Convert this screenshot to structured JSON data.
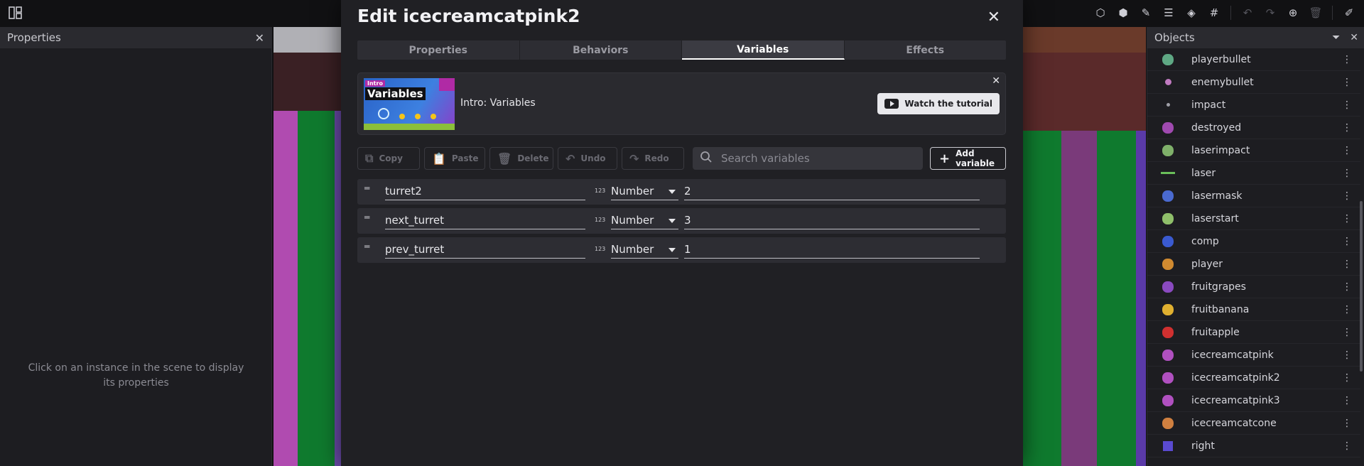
{
  "left_panel": {
    "title": "Properties",
    "empty_message": "Click on an instance in the scene to display its properties"
  },
  "objects_panel": {
    "title": "Objects",
    "items": [
      {
        "name": "playerbullet",
        "icon": "heart-icon",
        "color": "#5fa884"
      },
      {
        "name": "enemybullet",
        "icon": "dot-icon",
        "color": "#c07ac0"
      },
      {
        "name": "impact",
        "icon": "small-dot-icon",
        "color": "#a0a0a8"
      },
      {
        "name": "destroyed",
        "icon": "blob-icon",
        "color": "#a04ab0"
      },
      {
        "name": "laserimpact",
        "icon": "orb-icon",
        "color": "#7fb06a"
      },
      {
        "name": "laser",
        "icon": "line-icon",
        "color": "#6abf5a"
      },
      {
        "name": "lasermask",
        "icon": "mask-icon",
        "color": "#4a6ad0"
      },
      {
        "name": "laserstart",
        "icon": "orb-icon",
        "color": "#8fbf6a"
      },
      {
        "name": "comp",
        "icon": "robot-icon",
        "color": "#3a5ad0"
      },
      {
        "name": "player",
        "icon": "cat-icon",
        "color": "#d08a30"
      },
      {
        "name": "fruitgrapes",
        "icon": "grapes-icon",
        "color": "#8a4ac0"
      },
      {
        "name": "fruitbanana",
        "icon": "banana-icon",
        "color": "#e0b030"
      },
      {
        "name": "fruitapple",
        "icon": "apple-icon",
        "color": "#d03030"
      },
      {
        "name": "icecreamcatpink",
        "icon": "icecream-icon",
        "color": "#b050c0"
      },
      {
        "name": "icecreamcatpink2",
        "icon": "icecream-icon",
        "color": "#b050c0"
      },
      {
        "name": "icecreamcatpink3",
        "icon": "icecream-icon",
        "color": "#b050c0"
      },
      {
        "name": "icecreamcatcone",
        "icon": "cone-icon",
        "color": "#d08040"
      },
      {
        "name": "right",
        "icon": "arrow-icon",
        "color": "#5a4ad0"
      }
    ]
  },
  "dialog": {
    "title": "Edit icecreamcatpink2",
    "tabs": [
      "Properties",
      "Behaviors",
      "Variables",
      "Effects"
    ],
    "active_tab": "Variables",
    "tutorial": {
      "thumb_tag": "Intro",
      "thumb_title": "Variables",
      "label": "Intro: Variables",
      "watch_label": "Watch the tutorial"
    },
    "actions": {
      "copy": "Copy",
      "paste": "Paste",
      "delete": "Delete",
      "undo": "Undo",
      "redo": "Redo",
      "search_placeholder": "Search variables",
      "add": "Add variable"
    },
    "variables": [
      {
        "name": "turret2",
        "type_icon": "123",
        "type": "Number",
        "value": "2"
      },
      {
        "name": "next_turret",
        "type_icon": "123",
        "type": "Number",
        "value": "3"
      },
      {
        "name": "prev_turret",
        "type_icon": "123",
        "type": "Number",
        "value": "1"
      }
    ]
  }
}
